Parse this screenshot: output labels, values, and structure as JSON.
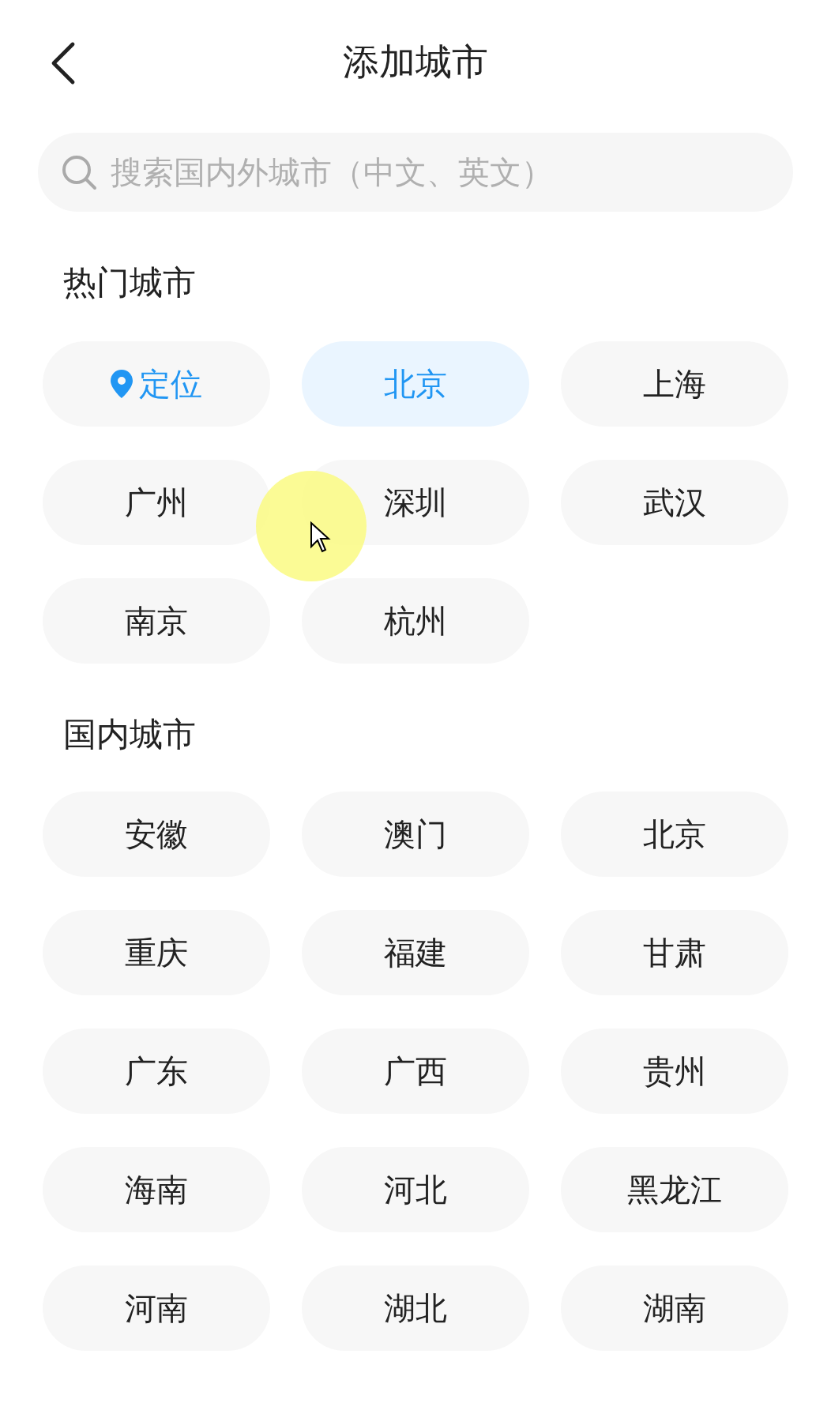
{
  "header": {
    "title": "添加城市"
  },
  "search": {
    "placeholder": "搜索国内外城市（中文、英文）"
  },
  "sections": [
    {
      "title": "热门城市",
      "items": [
        {
          "label": "定位",
          "kind": "location",
          "selected": false
        },
        {
          "label": "北京",
          "kind": "city",
          "selected": true
        },
        {
          "label": "上海",
          "kind": "city",
          "selected": false
        },
        {
          "label": "广州",
          "kind": "city",
          "selected": false
        },
        {
          "label": "深圳",
          "kind": "city",
          "selected": false
        },
        {
          "label": "武汉",
          "kind": "city",
          "selected": false
        },
        {
          "label": "南京",
          "kind": "city",
          "selected": false
        },
        {
          "label": "杭州",
          "kind": "city",
          "selected": false
        }
      ]
    },
    {
      "title": "国内城市",
      "items": [
        {
          "label": "安徽",
          "kind": "city",
          "selected": false
        },
        {
          "label": "澳门",
          "kind": "city",
          "selected": false
        },
        {
          "label": "北京",
          "kind": "city",
          "selected": false
        },
        {
          "label": "重庆",
          "kind": "city",
          "selected": false
        },
        {
          "label": "福建",
          "kind": "city",
          "selected": false
        },
        {
          "label": "甘肃",
          "kind": "city",
          "selected": false
        },
        {
          "label": "广东",
          "kind": "city",
          "selected": false
        },
        {
          "label": "广西",
          "kind": "city",
          "selected": false
        },
        {
          "label": "贵州",
          "kind": "city",
          "selected": false
        },
        {
          "label": "海南",
          "kind": "city",
          "selected": false
        },
        {
          "label": "河北",
          "kind": "city",
          "selected": false
        },
        {
          "label": "黑龙江",
          "kind": "city",
          "selected": false
        },
        {
          "label": "河南",
          "kind": "city",
          "selected": false
        },
        {
          "label": "湖北",
          "kind": "city",
          "selected": false
        },
        {
          "label": "湖南",
          "kind": "city",
          "selected": false
        }
      ]
    }
  ]
}
